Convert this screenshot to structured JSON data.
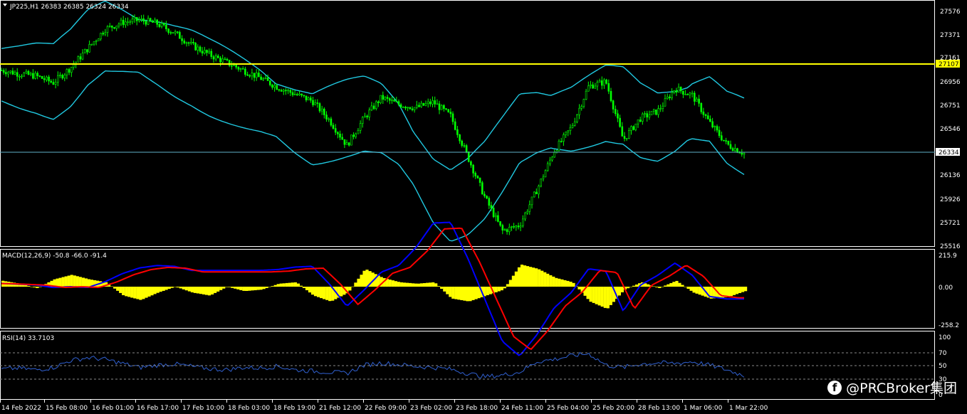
{
  "main_panel": {
    "symbol_info": "JP225,H1  26383 26385 26324 26334",
    "price_labels": [
      "27576",
      "27371",
      "27161",
      "26956",
      "26751",
      "26546",
      "26136",
      "25926",
      "25721",
      "25516"
    ],
    "horizontal_level": "27107",
    "current_price": "26334",
    "colors": {
      "candles": "#00ff00",
      "bands": "#20c8e0",
      "level": "#ffff00",
      "price_line": "#5fb0c8"
    }
  },
  "macd_panel": {
    "label": "MACD(12,26,9) -50.8 -66.0 -91.4",
    "scale": [
      "215.9",
      "0.00",
      "-258.2"
    ],
    "colors": {
      "histogram": "#ffff00",
      "macd": "#0000ff",
      "signal": "#ff0000"
    }
  },
  "rsi_panel": {
    "label": "RSI(14) 33.7103",
    "scale": [
      "100",
      "70",
      "50",
      "30",
      "0"
    ],
    "color": "#3060d0"
  },
  "time_axis": [
    "14 Feb 2022",
    "15 Feb 08:00",
    "16 Feb 01:00",
    "16 Feb 17:00",
    "17 Feb 10:00",
    "18 Feb 03:00",
    "18 Feb 19:00",
    "21 Feb 12:00",
    "22 Feb 09:00",
    "23 Feb 02:00",
    "23 Feb 18:00",
    "24 Feb 11:00",
    "25 Feb 04:00",
    "25 Feb 20:00",
    "28 Feb 13:00",
    "1 Mar 06:00",
    "1 Mar 22:00"
  ],
  "watermark": {
    "icon": "facebook-icon",
    "text": "@PRCBroker集团"
  },
  "chart_data": {
    "type": "line",
    "title": "JP225,H1",
    "price_path": [
      27060,
      27030,
      27010,
      26950,
      27080,
      27250,
      27420,
      27480,
      27500,
      27470,
      27390,
      27280,
      27200,
      27130,
      27060,
      26990,
      26910,
      26850,
      26790,
      26620,
      26400,
      26640,
      26820,
      26760,
      26730,
      26780,
      26660,
      26300,
      25940,
      25650,
      25700,
      26010,
      26350,
      26560,
      26920,
      26960,
      26450,
      26640,
      26700,
      26900,
      26840,
      26600,
      26410,
      26330
    ],
    "band_mid": [
      27020,
      27000,
      26990,
      26960,
      27080,
      27260,
      27360,
      27320,
      27270,
      27210,
      27140,
      27080,
      27000,
      26930,
      26860,
      26790,
      26700,
      26610,
      26540,
      26590,
      26640,
      26680,
      26640,
      26500,
      26250,
      26000,
      25870,
      25950,
      26100,
      26320,
      26550,
      26600,
      26610,
      26630,
      26700,
      26770,
      26750,
      26620,
      26560,
      26610,
      26700,
      26720,
      26560,
      26480
    ],
    "macd_hist": [
      40,
      20,
      -10,
      50,
      80,
      50,
      30,
      -60,
      -90,
      -40,
      0,
      -40,
      -60,
      0,
      -30,
      -20,
      20,
      30,
      -60,
      -100,
      -40,
      120,
      60,
      30,
      20,
      30,
      -80,
      -100,
      -60,
      -20,
      150,
      120,
      60,
      30,
      -100,
      -150,
      -20,
      30,
      -10,
      40,
      -40,
      -80,
      -70,
      -30
    ],
    "rsi": [
      45,
      47,
      44,
      48,
      60,
      65,
      62,
      55,
      48,
      52,
      54,
      50,
      46,
      44,
      48,
      47,
      50,
      44,
      42,
      40,
      38,
      52,
      56,
      53,
      50,
      48,
      45,
      38,
      32,
      35,
      40,
      58,
      62,
      68,
      72,
      52,
      48,
      54,
      56,
      55,
      58,
      52,
      44,
      34
    ]
  }
}
